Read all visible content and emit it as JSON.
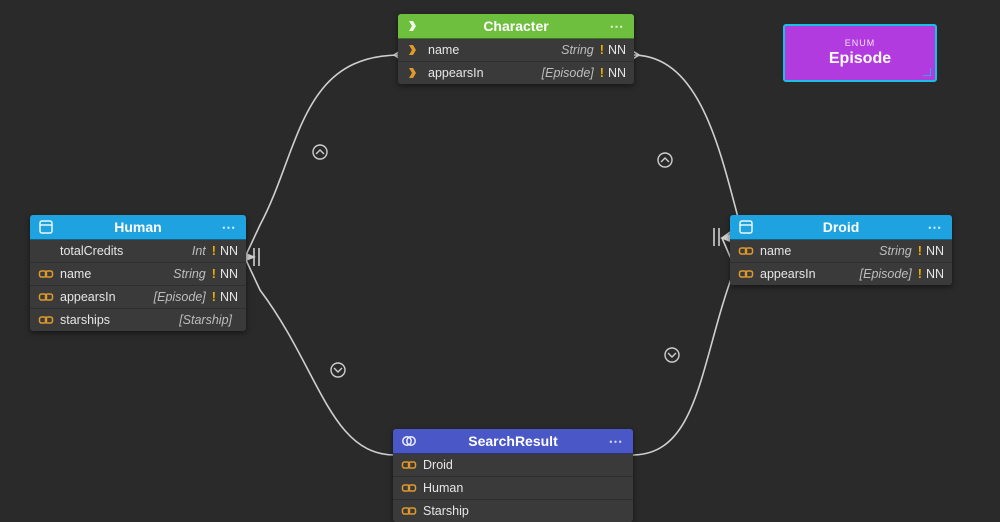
{
  "nodes": {
    "character": {
      "title": "Character",
      "header_color": "green",
      "fields": [
        {
          "icon": "fork-icon",
          "name": "name",
          "type": "String",
          "nn": "NN"
        },
        {
          "icon": "fork-icon",
          "name": "appearsIn",
          "type": "[Episode]",
          "nn": "NN"
        }
      ]
    },
    "human": {
      "title": "Human",
      "header_color": "blue",
      "fields": [
        {
          "icon": "",
          "name": "totalCredits",
          "type": "Int",
          "nn": "NN"
        },
        {
          "icon": "link-icon",
          "name": "name",
          "type": "String",
          "nn": "NN"
        },
        {
          "icon": "link-icon",
          "name": "appearsIn",
          "type": "[Episode]",
          "nn": "NN"
        },
        {
          "icon": "link-icon",
          "name": "starships",
          "type": "[Starship]",
          "nn": ""
        }
      ]
    },
    "droid": {
      "title": "Droid",
      "header_color": "blue",
      "fields": [
        {
          "icon": "link-icon",
          "name": "name",
          "type": "String",
          "nn": "NN"
        },
        {
          "icon": "link-icon",
          "name": "appearsIn",
          "type": "[Episode]",
          "nn": "NN"
        }
      ]
    },
    "searchresult": {
      "title": "SearchResult",
      "header_color": "purple-dk",
      "fields": [
        {
          "icon": "link-icon",
          "name": "Droid"
        },
        {
          "icon": "link-icon",
          "name": "Human"
        },
        {
          "icon": "link-icon",
          "name": "Starship"
        }
      ]
    },
    "episode": {
      "kind": "enum",
      "tag": "ENUM",
      "title": "Episode",
      "bg": "#b23be0"
    }
  },
  "dots": "⋯"
}
